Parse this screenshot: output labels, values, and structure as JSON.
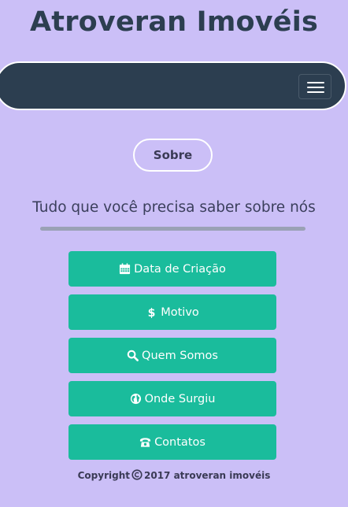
{
  "header": {
    "site_title": "Atroveran Imovéis"
  },
  "navbar": {
    "toggle_icon": "hamburger-menu-icon"
  },
  "about": {
    "sobre_label": "Sobre",
    "subtitle": "Tudo que você precisa saber sobre nós"
  },
  "menu": {
    "items": [
      {
        "label": "Data de Criação",
        "icon": "calendar-icon"
      },
      {
        "label": "Motivo",
        "icon": "dollar-icon"
      },
      {
        "label": "Quem Somos",
        "icon": "search-icon"
      },
      {
        "label": "Onde Surgiu",
        "icon": "globe-icon"
      },
      {
        "label": "Contatos",
        "icon": "phone-icon"
      }
    ]
  },
  "footer": {
    "copyright_prefix": "Copyright",
    "copyright_suffix": "2017 atroveran imovéis"
  },
  "colors": {
    "background": "#cbbff7",
    "navbar": "#2c3e50",
    "button": "#1abc9c",
    "title": "#2c3e50"
  }
}
